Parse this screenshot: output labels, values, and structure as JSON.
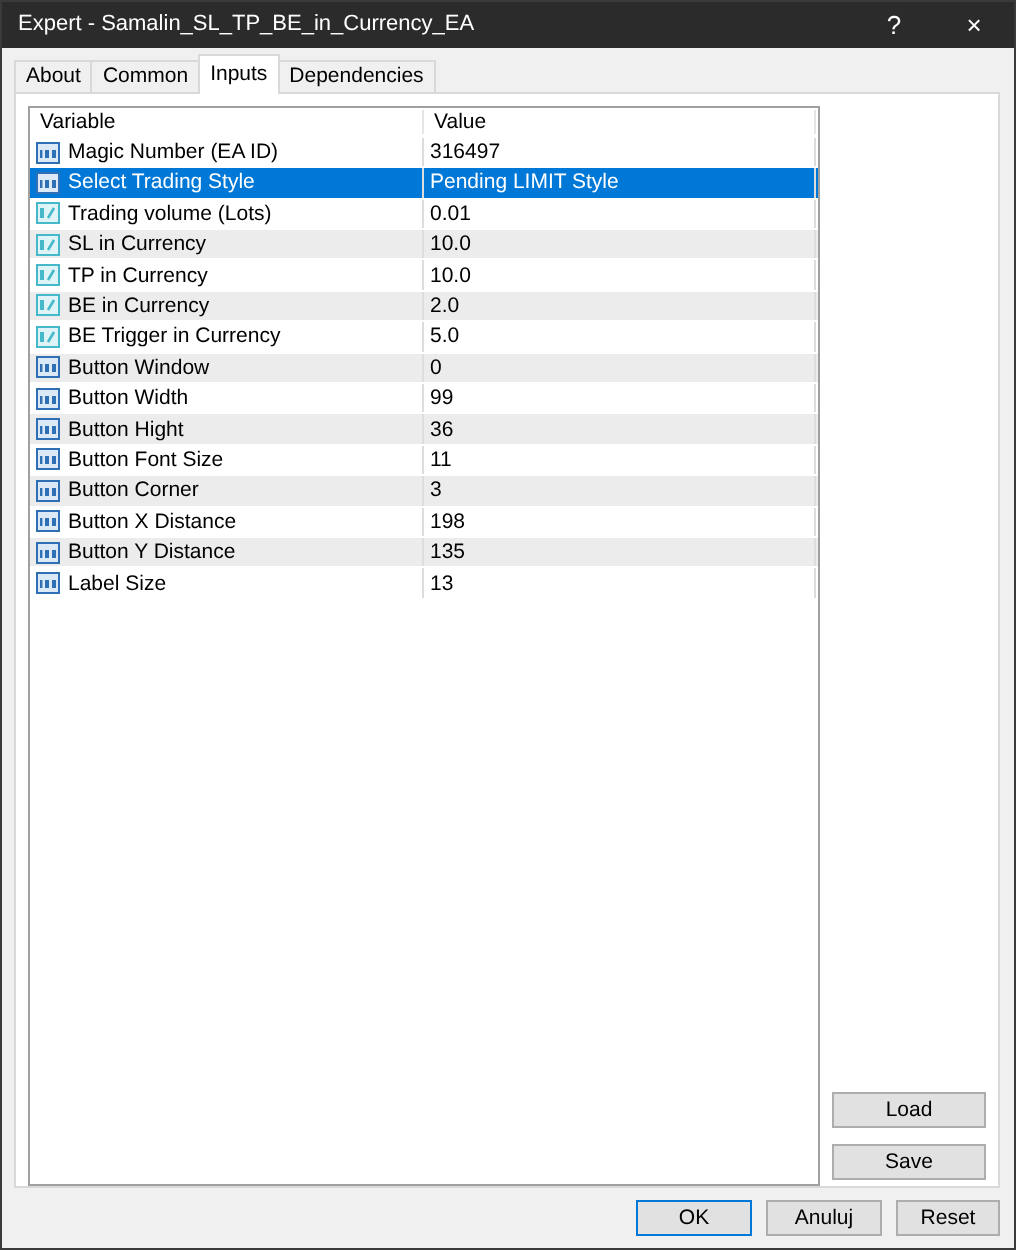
{
  "window": {
    "title": "Expert - Samalin_SL_TP_BE_in_Currency_EA",
    "help": "?",
    "close": "×"
  },
  "tabs": [
    {
      "label": "About",
      "selected": false
    },
    {
      "label": "Common",
      "selected": false
    },
    {
      "label": "Inputs",
      "selected": true
    },
    {
      "label": "Dependencies",
      "selected": false
    }
  ],
  "table": {
    "columns": [
      "Variable",
      "Value"
    ],
    "rows": [
      {
        "kind": "int",
        "variable": "Magic Number (EA ID)",
        "value": "316497",
        "selected": false
      },
      {
        "kind": "int",
        "variable": "Select Trading Style",
        "value": "Pending LIMIT Style",
        "selected": true
      },
      {
        "kind": "double",
        "variable": "Trading volume (Lots)",
        "value": "0.01",
        "selected": false
      },
      {
        "kind": "double",
        "variable": "SL in Currency",
        "value": "10.0",
        "selected": false
      },
      {
        "kind": "double",
        "variable": "TP in Currency",
        "value": "10.0",
        "selected": false
      },
      {
        "kind": "double",
        "variable": "BE in Currency",
        "value": "2.0",
        "selected": false
      },
      {
        "kind": "double",
        "variable": "BE Trigger in Currency",
        "value": "5.0",
        "selected": false
      },
      {
        "kind": "int",
        "variable": "Button Window",
        "value": "0",
        "selected": false
      },
      {
        "kind": "int",
        "variable": "Button Width",
        "value": "99",
        "selected": false
      },
      {
        "kind": "int",
        "variable": "Button Hight",
        "value": "36",
        "selected": false
      },
      {
        "kind": "int",
        "variable": "Button Font Size",
        "value": "11",
        "selected": false
      },
      {
        "kind": "int",
        "variable": "Button Corner",
        "value": "3",
        "selected": false
      },
      {
        "kind": "int",
        "variable": "Button X Distance",
        "value": "198",
        "selected": false
      },
      {
        "kind": "int",
        "variable": "Button Y Distance",
        "value": "135",
        "selected": false
      },
      {
        "kind": "int",
        "variable": "Label Size",
        "value": "13",
        "selected": false
      }
    ]
  },
  "side_buttons": [
    "Load",
    "Save"
  ],
  "footer_buttons": [
    {
      "label": "OK",
      "default": true
    },
    {
      "label": "Anuluj",
      "default": false
    },
    {
      "label": "Reset",
      "default": false
    }
  ]
}
